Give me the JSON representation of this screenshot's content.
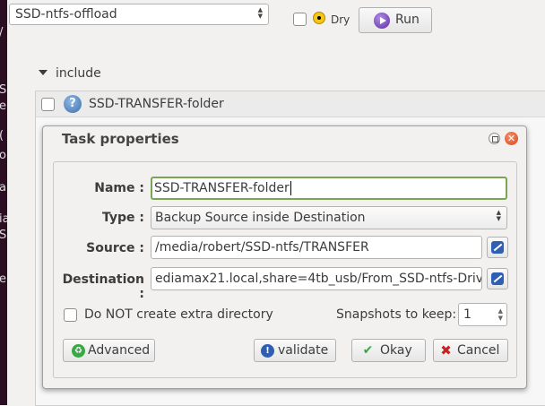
{
  "toolbar": {
    "profile_value": "SSD-ntfs-offload",
    "dry_label": "Dry",
    "run_label": "Run"
  },
  "background_fragments": [
    "/",
    "S",
    "e",
    "(",
    "o",
    "a",
    "ia",
    "S",
    "e"
  ],
  "include": {
    "label": "include",
    "row_label": "SSD-TRANSFER-folder"
  },
  "dialog": {
    "title": "Task properties",
    "name_label": "Name :",
    "name_value": "SSD-TRANSFER-folder",
    "type_label": "Type :",
    "type_value": "Backup Source inside Destination",
    "source_label": "Source :",
    "source_value": "/media/robert/SSD-ntfs/TRANSFER",
    "destination_label": "Destination :",
    "destination_value": "ediamax21.local,share=4tb_usb/From_SSD-ntfs-Drive/",
    "no_extra_dir_label": "Do NOT create extra directory",
    "snapshots_label": "Snapshots to keep:",
    "snapshots_value": "1",
    "advanced_label": "Advanced",
    "validate_label": "validate",
    "okay_label": "Okay",
    "cancel_label": "Cancel"
  },
  "icons": {
    "dry": "radiation-icon",
    "run": "play-icon",
    "row": "question-icon",
    "advanced": "recycle-icon",
    "validate": "info-icon",
    "okay": "checkmark-icon",
    "cancel": "x-icon",
    "browse": "edit-icon"
  },
  "colors": {
    "accent_green": "#7aa654",
    "close_orange": "#d9461c",
    "terminal_bg": "#2b0e22"
  }
}
